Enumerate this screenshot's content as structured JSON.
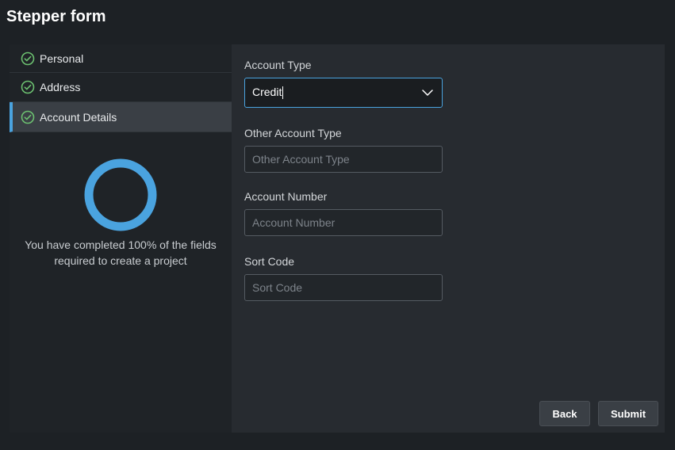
{
  "header": {
    "title": "Stepper form"
  },
  "steps": [
    {
      "label": "Personal",
      "icon": "check-circle-icon"
    },
    {
      "label": "Address",
      "icon": "check-circle-icon"
    },
    {
      "label": "Account Details",
      "icon": "check-circle-icon"
    }
  ],
  "progress": {
    "percent": 100,
    "text": "You have completed 100% of the fields required to create a project"
  },
  "form": {
    "account_type": {
      "label": "Account Type",
      "value": "Credit"
    },
    "other_account_type": {
      "label": "Other Account Type",
      "placeholder": "Other Account Type",
      "value": ""
    },
    "account_number": {
      "label": "Account Number",
      "placeholder": "Account Number",
      "value": ""
    },
    "sort_code": {
      "label": "Sort Code",
      "placeholder": "Sort Code",
      "value": ""
    }
  },
  "buttons": {
    "back": "Back",
    "submit": "Submit"
  },
  "colors": {
    "accent": "#4aa3df",
    "check": "#6cc070",
    "background": "#1d2125"
  }
}
